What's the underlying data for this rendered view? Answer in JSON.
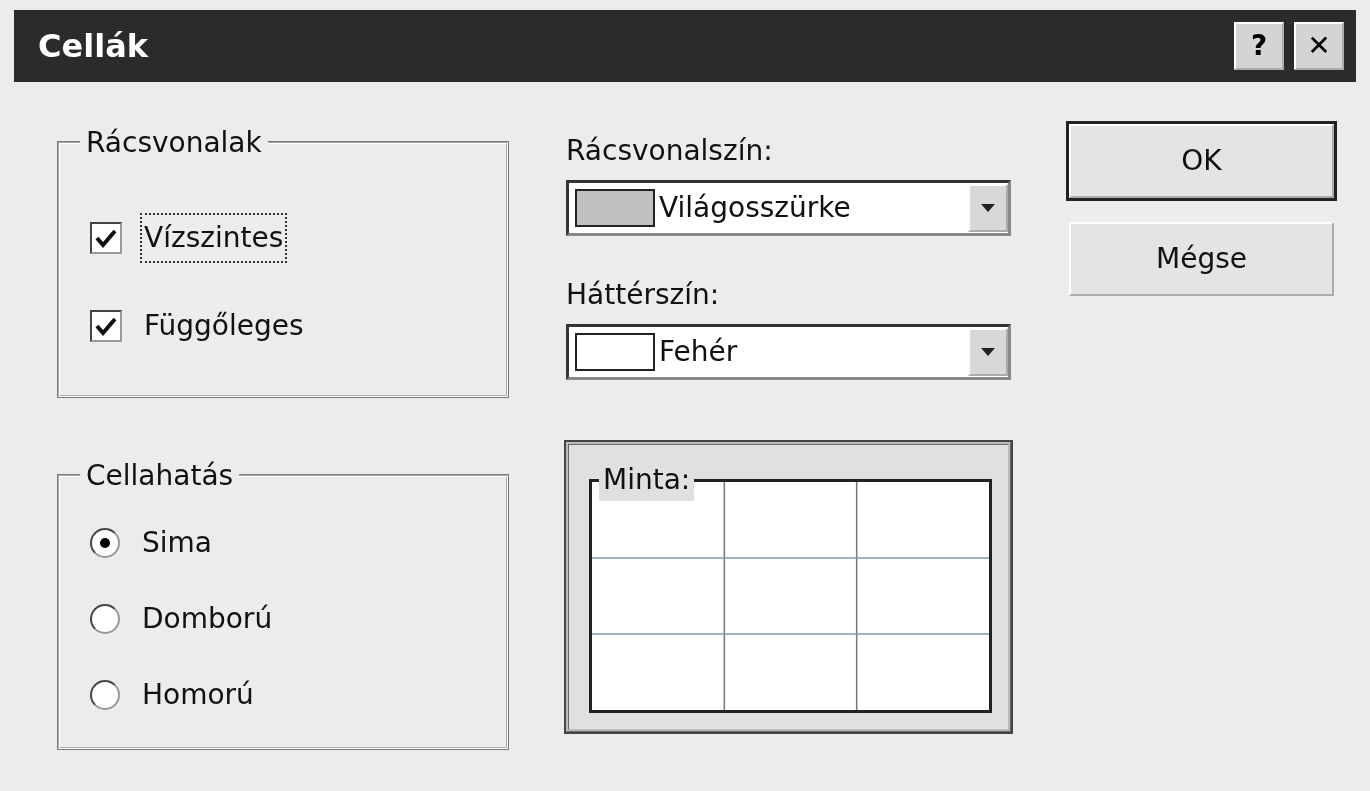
{
  "window": {
    "title": "Cellák",
    "controls": [
      {
        "kind": "help",
        "label": "?"
      },
      {
        "kind": "close",
        "label": "✕"
      }
    ]
  },
  "gridlines": {
    "title": "Rácsvonalak",
    "options": [
      {
        "label": "Vízszintes",
        "checked": true,
        "focused": true
      },
      {
        "label": "Függőleges",
        "checked": true,
        "focused": false
      }
    ]
  },
  "cell_effect": {
    "title": "Cellahatás",
    "options": [
      {
        "label": "Sima",
        "selected": true
      },
      {
        "label": "Domború",
        "selected": false
      },
      {
        "label": "Homorú",
        "selected": false
      }
    ]
  },
  "dropdowns": [
    {
      "label": "Rácsvonalszín:",
      "value": "Világosszürke",
      "color": "#c0c0c0"
    },
    {
      "label": "Háttérszín:",
      "value": "Fehér",
      "color": "#ffffff"
    }
  ],
  "preview": {
    "title": "Minta:"
  },
  "buttons": [
    {
      "label": "OK",
      "default": true
    },
    {
      "label": "Mégse",
      "default": false
    }
  ]
}
